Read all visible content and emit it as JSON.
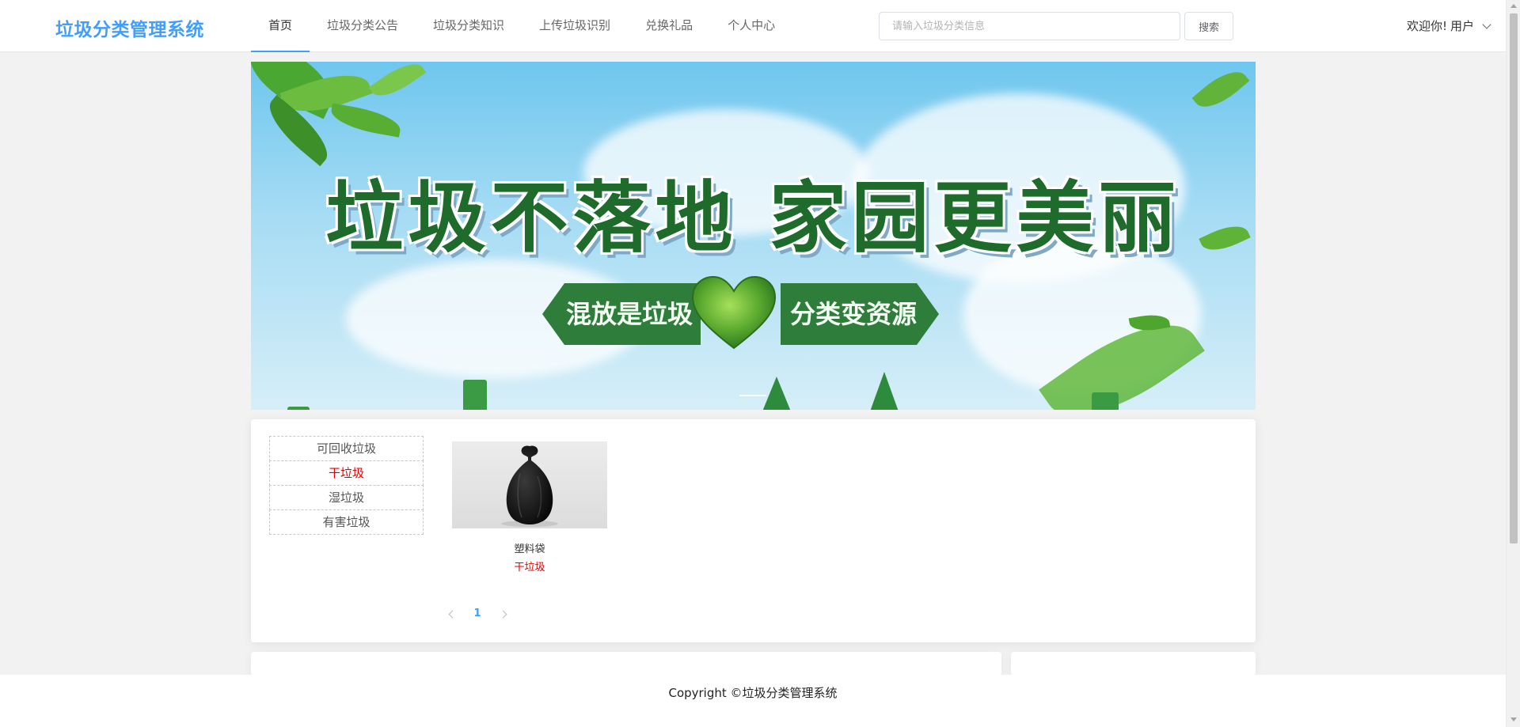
{
  "app": {
    "title": "垃圾分类管理系统",
    "brand_color": "#409eff"
  },
  "nav": {
    "items": [
      {
        "label": "首页",
        "active": true
      },
      {
        "label": "垃圾分类公告",
        "active": false
      },
      {
        "label": "垃圾分类知识",
        "active": false
      },
      {
        "label": "上传垃圾识别",
        "active": false
      },
      {
        "label": "兑换礼品",
        "active": false
      },
      {
        "label": "个人中心",
        "active": false
      }
    ]
  },
  "search": {
    "placeholder": "请输入垃圾分类信息",
    "value": "",
    "button_label": "搜索"
  },
  "user": {
    "greeting": "欢迎你!",
    "name": "用户",
    "icon": "chevron-down-icon"
  },
  "banner": {
    "headline": "垃圾不落地 家园更美丽",
    "left_tag": "混放是垃圾",
    "right_tag": "分类变资源",
    "icon": "heart-icon"
  },
  "categories": {
    "items": [
      {
        "label": "可回收垃圾",
        "active": false
      },
      {
        "label": "干垃圾",
        "active": true
      },
      {
        "label": "湿垃圾",
        "active": false
      },
      {
        "label": "有害垃圾",
        "active": false
      }
    ],
    "active_color": "#e60000"
  },
  "products": [
    {
      "name": "塑料袋",
      "category": "干垃圾",
      "image": "black-garbage-bag"
    }
  ],
  "pagination": {
    "current_page": "1",
    "prev_icon": "chevron-left-icon",
    "next_icon": "chevron-right-icon"
  },
  "footer": {
    "copyright": "Copyright ©垃圾分类管理系统"
  }
}
